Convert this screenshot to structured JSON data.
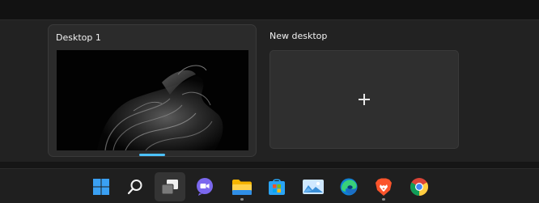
{
  "task_view": {
    "desktops": [
      {
        "label": "Desktop 1",
        "active": true
      },
      {
        "label": "New desktop",
        "action": "add"
      }
    ]
  },
  "taskbar": {
    "items": [
      {
        "name": "start",
        "icon": "windows-logo-icon"
      },
      {
        "name": "search",
        "icon": "search-icon"
      },
      {
        "name": "task-view",
        "icon": "task-view-icon",
        "pressed": true
      },
      {
        "name": "teams-chat",
        "icon": "chat-icon"
      },
      {
        "name": "file-explorer",
        "icon": "folder-icon",
        "running": true
      },
      {
        "name": "microsoft-store",
        "icon": "store-icon"
      },
      {
        "name": "photos",
        "icon": "photos-icon"
      },
      {
        "name": "edge",
        "icon": "edge-icon"
      },
      {
        "name": "brave",
        "icon": "brave-icon",
        "running": true
      },
      {
        "name": "chrome",
        "icon": "chrome-icon"
      }
    ]
  },
  "colors": {
    "accent": "#4cc2ff",
    "taskbar_bg": "#1f1f1f",
    "card_bg": "#2b2b2b"
  }
}
